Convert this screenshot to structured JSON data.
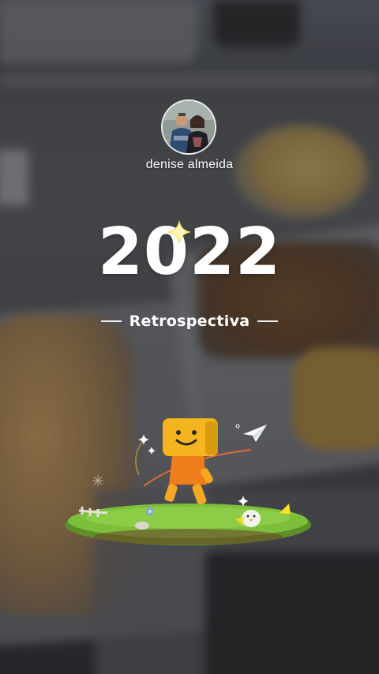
{
  "profile": {
    "username": "denise almeida"
  },
  "recap": {
    "year": "2022",
    "subtitle": "Retrospectiva"
  },
  "icons": {
    "sparkle": "sparkle-icon",
    "paper_plane": "paper-plane-icon",
    "mascot": "box-head-mascot"
  },
  "colors": {
    "text": "#ffffff",
    "mascot_head": "#f5b51e",
    "mascot_body": "#ef7d1a",
    "grass": "#7cbf3a"
  }
}
